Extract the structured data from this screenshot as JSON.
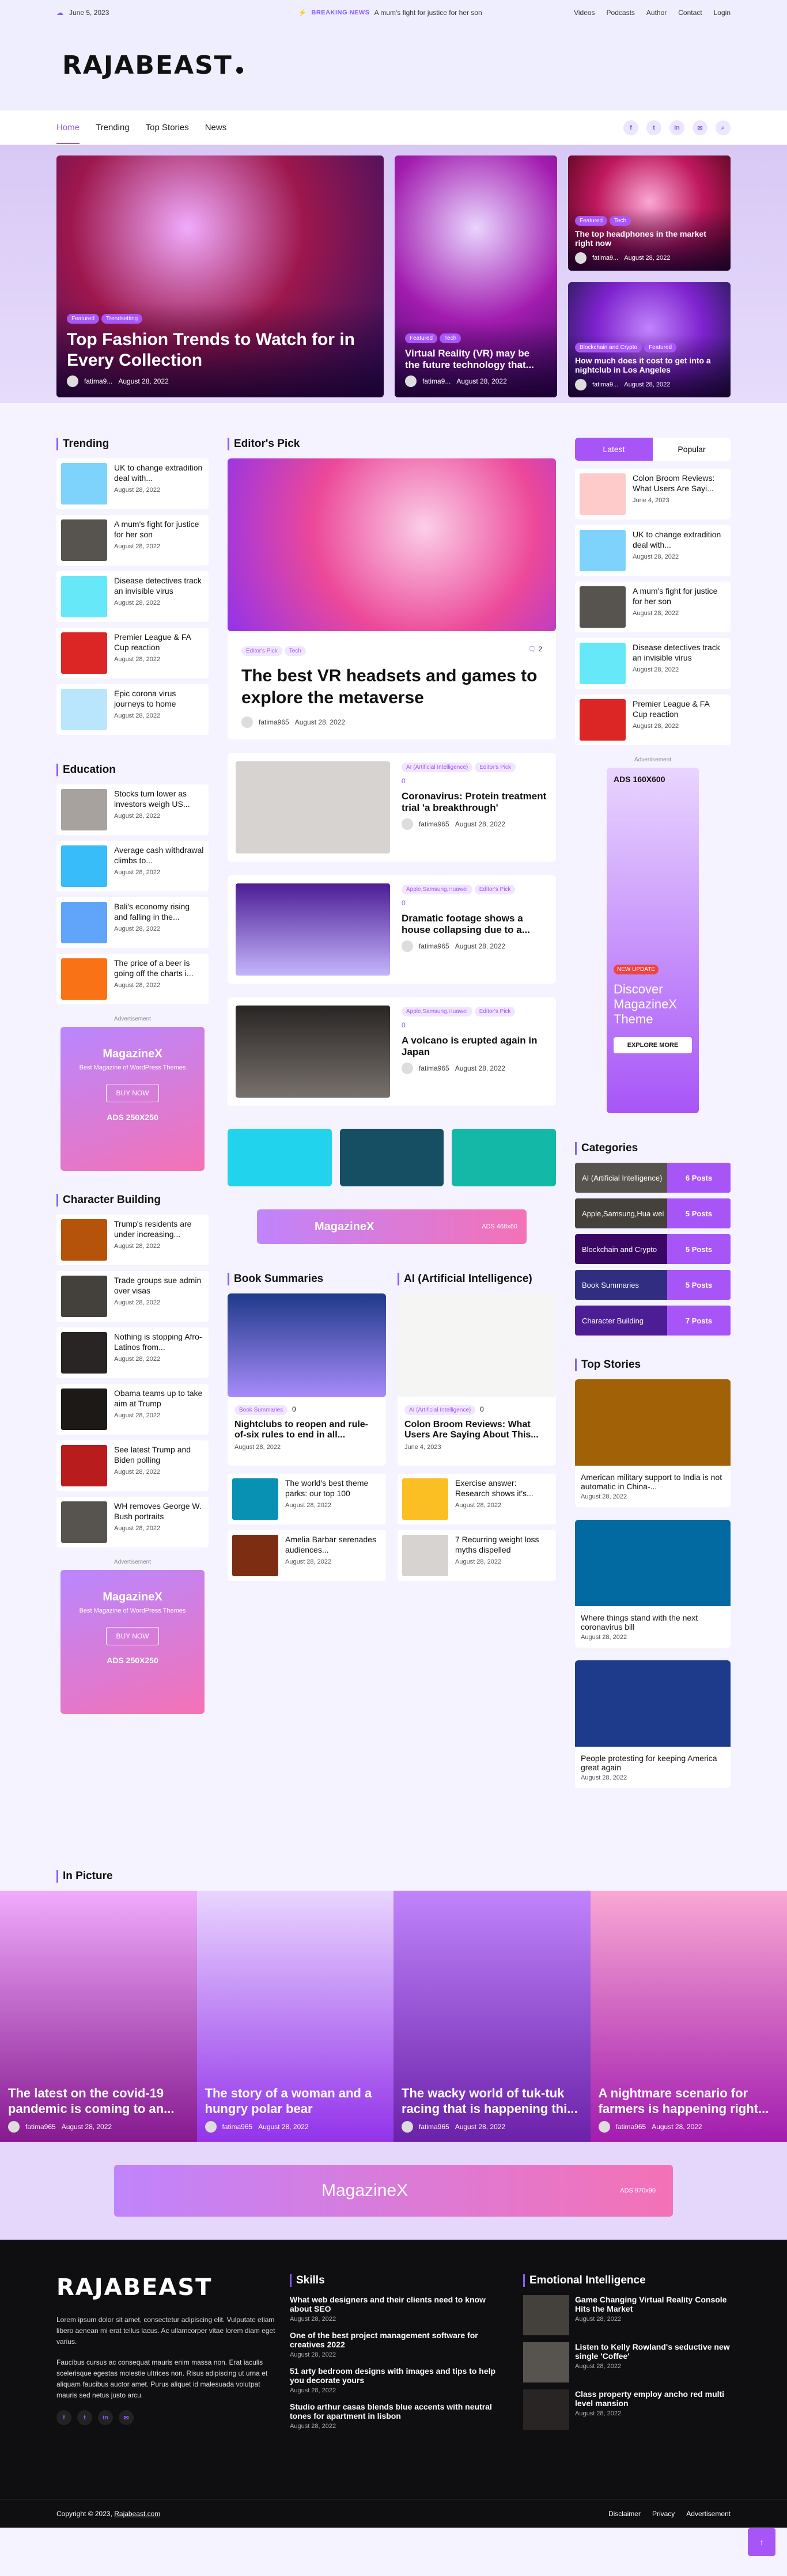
{
  "topbar": {
    "date": "June 5, 2023",
    "breaking_label": "BREAKING NEWS",
    "breaking_text": "A mum's fight for justice for her son",
    "links": [
      "Videos",
      "Podcasts",
      "Author",
      "Contact",
      "Login"
    ]
  },
  "logo": "RAJABEAST",
  "nav": {
    "items": [
      "Home",
      "Trending",
      "Top Stories",
      "News"
    ]
  },
  "hero": {
    "main": {
      "tags": [
        "Featured",
        "Trendsetting"
      ],
      "title": "Top Fashion Trends to Watch for in Every Collection",
      "author": "fatima9...",
      "date": "August 28, 2022"
    },
    "middle": {
      "tags": [
        "Featured",
        "Tech"
      ],
      "title": "Virtual Reality (VR) may be the future technology that...",
      "author": "fatima9...",
      "date": "August 28, 2022"
    },
    "right_top": {
      "tags": [
        "Featured",
        "Tech"
      ],
      "title": "The top headphones in the market right now",
      "author": "fatima9...",
      "date": "August 28, 2022"
    },
    "right_bottom": {
      "tags": [
        "Blockchain and Crypto",
        "Featured"
      ],
      "title": "How much does it cost to get into a nightclub in Los Angeles",
      "author": "fatima9...",
      "date": "August 28, 2022"
    }
  },
  "trending": {
    "title": "Trending",
    "items": [
      {
        "t": "UK to change extradition deal with...",
        "d": "August 28, 2022"
      },
      {
        "t": "A mum's fight for justice for her son",
        "d": "August 28, 2022"
      },
      {
        "t": "Disease detectives track an invisible virus",
        "d": "August 28, 2022"
      },
      {
        "t": "Premier League & FA Cup reaction",
        "d": "August 28, 2022"
      },
      {
        "t": "Epic corona virus journeys to home",
        "d": "August 28, 2022"
      }
    ]
  },
  "education": {
    "title": "Education",
    "items": [
      {
        "t": "Stocks turn lower as investors weigh US...",
        "d": "August 28, 2022"
      },
      {
        "t": "Average cash withdrawal climbs to...",
        "d": "August 28, 2022"
      },
      {
        "t": "Bali's economy rising and falling in the...",
        "d": "August 28, 2022"
      },
      {
        "t": "The price of a beer is going off the charts i...",
        "d": "August 28, 2022"
      }
    ]
  },
  "ad_label": "Advertisement",
  "ad_small": {
    "title": "MagazineX",
    "sub": "Best Magazine of WordPress Themes",
    "btn": "BUY NOW",
    "size": "ADS 250X250"
  },
  "character": {
    "title": "Character Building",
    "items": [
      {
        "t": "Trump's residents are under increasing...",
        "d": "August 28, 2022"
      },
      {
        "t": "Trade groups sue admin over visas",
        "d": "August 28, 2022"
      },
      {
        "t": "Nothing is stopping Afro-Latinos from...",
        "d": "August 28, 2022"
      },
      {
        "t": "Obama teams up to take aim at Trump",
        "d": "August 28, 2022"
      },
      {
        "t": "See latest Trump and Biden polling",
        "d": "August 28, 2022"
      },
      {
        "t": "WH removes George W. Bush portraits",
        "d": "August 28, 2022"
      }
    ]
  },
  "editors": {
    "title": "Editor's Pick",
    "feature": {
      "tags": [
        "Editor's Pick",
        "Tech"
      ],
      "comments": "2",
      "title": "The best VR headsets and games to explore the metaverse",
      "author": "fatima965",
      "date": "August 28, 2022"
    },
    "list": [
      {
        "tags": [
          "AI (Artificial Intelligence)",
          "Editor's Pick"
        ],
        "c": "0",
        "t": "Coronavirus: Protein treatment trial 'a breakthrough'",
        "a": "fatima965",
        "d": "August 28, 2022"
      },
      {
        "tags": [
          "Apple,Samsung,Huawei",
          "Editor's Pick"
        ],
        "c": "0",
        "t": "Dramatic footage shows a house collapsing due to a...",
        "a": "fatima965",
        "d": "August 28, 2022"
      },
      {
        "tags": [
          "Apple,Samsung,Huawei",
          "Editor's Pick"
        ],
        "c": "0",
        "t": "A volcano is erupted again in Japan",
        "a": "fatima965",
        "d": "August 28, 2022"
      }
    ]
  },
  "banner": {
    "title": "MagazineX",
    "size": "ADS 468x60"
  },
  "books": {
    "title": "Book Summaries",
    "main": {
      "tag": "Book Summaries",
      "c": "0",
      "t": "Nightclubs to reopen and rule-of-six rules to end in all...",
      "d": "August 28, 2022"
    },
    "items": [
      {
        "t": "The world's best theme parks: our top 100",
        "d": "August 28, 2022"
      },
      {
        "t": "Amelia Barbar serenades audiences...",
        "d": "August 28, 2022"
      }
    ]
  },
  "ai": {
    "title": "AI (Artificial Intelligence)",
    "main": {
      "tag": "AI (Artificial Intelligence)",
      "c": "0",
      "t": "Colon Broom Reviews: What Users Are Saying About This...",
      "d": "June 4, 2023"
    },
    "items": [
      {
        "t": "Exercise answer: Research shows it's...",
        "d": "August 28, 2022"
      },
      {
        "t": "7 Recurring weight loss myths dispelled",
        "d": "August 28, 2022"
      }
    ]
  },
  "tabs": {
    "latest": "Latest",
    "popular": "Popular",
    "items": [
      {
        "t": "Colon Broom Reviews: What Users Are Sayi...",
        "d": "June 4, 2023"
      },
      {
        "t": "UK to change extradition deal with...",
        "d": "August 28, 2022"
      },
      {
        "t": "A mum's fight for justice for her son",
        "d": "August 28, 2022"
      },
      {
        "t": "Disease detectives track an invisible virus",
        "d": "August 28, 2022"
      },
      {
        "t": "Premier League & FA Cup reaction",
        "d": "August 28, 2022"
      }
    ]
  },
  "ad_tall": {
    "size": "ADS 160X600",
    "badge": "NEW UPDATE",
    "title": "Discover MagazineX Theme",
    "btn": "EXPLORE MORE"
  },
  "categories": {
    "title": "Categories",
    "items": [
      {
        "n": "AI (Artificial Intelligence)",
        "c": "6 Posts"
      },
      {
        "n": "Apple,Samsung,Hua wei",
        "c": "5 Posts"
      },
      {
        "n": "Blockchain and Crypto",
        "c": "5 Posts"
      },
      {
        "n": "Book Summaries",
        "c": "5 Posts"
      },
      {
        "n": "Character Building",
        "c": "7 Posts"
      }
    ]
  },
  "top_stories": {
    "title": "Top Stories",
    "items": [
      {
        "t": "American military support to India is not automatic in China-...",
        "d": "August 28, 2022"
      },
      {
        "t": "Where things stand with the next coronavirus bill",
        "d": "August 28, 2022"
      },
      {
        "t": "People protesting for keeping America great again",
        "d": "August 28, 2022"
      }
    ]
  },
  "in_picture": {
    "title": "In Picture",
    "items": [
      {
        "t": "The latest on the covid-19 pandemic is coming to an...",
        "a": "fatima965",
        "d": "August 28, 2022"
      },
      {
        "t": "The story of a woman and a hungry polar bear",
        "a": "fatima965",
        "d": "August 28, 2022"
      },
      {
        "t": "The wacky world of tuk-tuk racing that is happening thi...",
        "a": "fatima965",
        "d": "August 28, 2022"
      },
      {
        "t": "A nightmare scenario for farmers is happening right...",
        "a": "fatima965",
        "d": "August 28, 2022"
      }
    ]
  },
  "wide_banner": {
    "title": "MagazineX",
    "size": "ADS 970x90"
  },
  "footer": {
    "logo": "RAJABEAST",
    "about1": "Lorem ipsum dolor sit amet, consectetur adipiscing elit. Vulputate etiam libero aenean mi erat tellus lacus. Ac ullamcorper vitae lorem diam eget varius.",
    "about2": "Faucibus cursus ac consequat mauris enim massa non. Erat iaculis scelerisque egestas molestie ultrices non. Risus adipiscing ut urna et aliquam faucibus auctor amet. Purus aliquet id malesuada volutpat mauris sed netus justo arcu.",
    "skills": {
      "title": "Skills",
      "items": [
        {
          "t": "What web designers and their clients need to know about SEO",
          "d": "August 28, 2022"
        },
        {
          "t": "One of the best project management software for creatives 2022",
          "d": "August 28, 2022"
        },
        {
          "t": "51 arty bedroom designs with images and tips to help you decorate yours",
          "d": "August 28, 2022"
        },
        {
          "t": "Studio arthur casas blends blue accents with neutral tones for apartment in lisbon",
          "d": "August 28, 2022"
        }
      ]
    },
    "emotional": {
      "title": "Emotional Intelligence",
      "items": [
        {
          "t": "Game Changing Virtual Reality Console Hits the Market",
          "d": "August 28, 2022"
        },
        {
          "t": "Listen to Kelly Rowland's seductive new single 'Coffee'",
          "d": "August 28, 2022"
        },
        {
          "t": "Class property employ ancho red multi level mansion",
          "d": "August 28, 2022"
        }
      ]
    },
    "copyright": "Copyright © 2023,",
    "copyright_link": "Rajabeast.com",
    "links": [
      "Disclaimer",
      "Privacy",
      "Advertisement"
    ]
  }
}
